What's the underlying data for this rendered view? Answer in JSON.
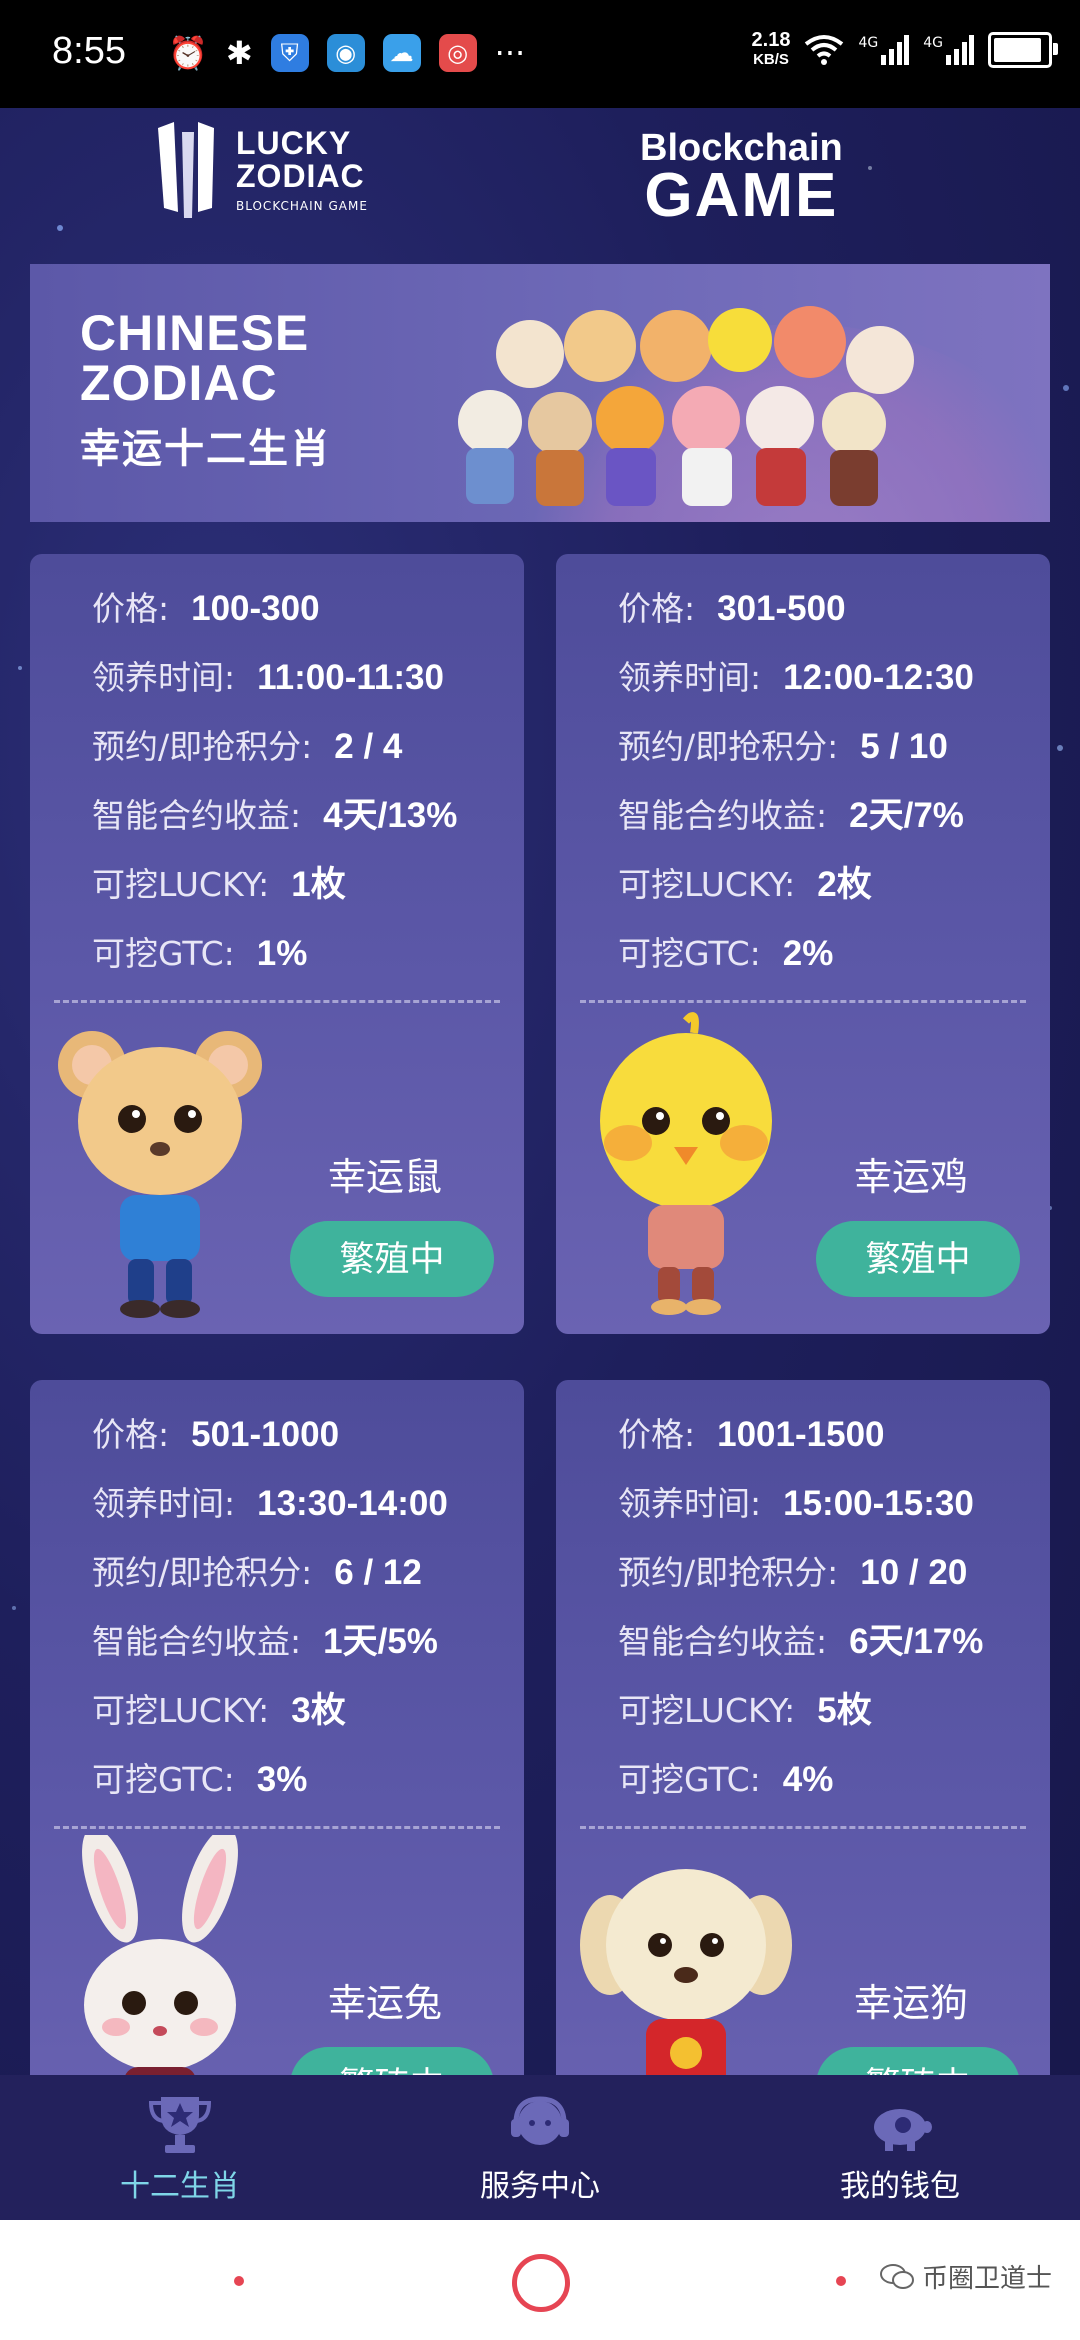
{
  "status_bar": {
    "time": "8:55",
    "network_speed_value": "2.18",
    "network_speed_unit": "KB/S",
    "signal_label_1": "4G",
    "signal_label_2": "4G",
    "more": "···",
    "battery_level": 0.9
  },
  "header": {
    "logo_left_line1": "LUCKY",
    "logo_left_line2": "ZODIAC",
    "logo_left_sub": "BLOCKCHAIN GAME",
    "logo_right_line1": "Blockchain",
    "logo_right_line2": "GAME"
  },
  "banner": {
    "line1": "CHINESE",
    "line2": "ZODIAC",
    "line3": "幸运十二生肖"
  },
  "cards": [
    {
      "price_label": "价格:",
      "price": "100-300",
      "time_label": "领养时间:",
      "time": "11:00-11:30",
      "points_label": "预约/即抢积分:",
      "points": "2 / 4",
      "yield_label": "智能合约收益:",
      "yield": "4天/13%",
      "lucky_label": "可挖LUCKY:",
      "lucky": "1枚",
      "gtc_label": "可挖GTC:",
      "gtc": "1%",
      "name": "幸运鼠",
      "button": "繁殖中",
      "icon": "rat-character-icon"
    },
    {
      "price_label": "价格:",
      "price": "301-500",
      "time_label": "领养时间:",
      "time": "12:00-12:30",
      "points_label": "预约/即抢积分:",
      "points": "5 / 10",
      "yield_label": "智能合约收益:",
      "yield": "2天/7%",
      "lucky_label": "可挖LUCKY:",
      "lucky": "2枚",
      "gtc_label": "可挖GTC:",
      "gtc": "2%",
      "name": "幸运鸡",
      "button": "繁殖中",
      "icon": "chicken-character-icon"
    },
    {
      "price_label": "价格:",
      "price": "501-1000",
      "time_label": "领养时间:",
      "time": "13:30-14:00",
      "points_label": "预约/即抢积分:",
      "points": "6 / 12",
      "yield_label": "智能合约收益:",
      "yield": "1天/5%",
      "lucky_label": "可挖LUCKY:",
      "lucky": "3枚",
      "gtc_label": "可挖GTC:",
      "gtc": "3%",
      "name": "幸运兔",
      "button": "繁殖中",
      "icon": "rabbit-character-icon"
    },
    {
      "price_label": "价格:",
      "price": "1001-1500",
      "time_label": "领养时间:",
      "time": "15:00-15:30",
      "points_label": "预约/即抢积分:",
      "points": "10 / 20",
      "yield_label": "智能合约收益:",
      "yield": "6天/17%",
      "lucky_label": "可挖LUCKY:",
      "lucky": "5枚",
      "gtc_label": "可挖GTC:",
      "gtc": "4%",
      "name": "幸运狗",
      "button": "繁殖中",
      "icon": "dog-character-icon"
    }
  ],
  "bottom_nav": [
    {
      "label": "十二生肖",
      "icon": "trophy-icon",
      "active": true
    },
    {
      "label": "服务中心",
      "icon": "headset-icon",
      "active": false
    },
    {
      "label": "我的钱包",
      "icon": "piggy-bank-icon",
      "active": false
    }
  ],
  "watermark": {
    "text": "币圈卫道士",
    "icon": "wechat-icon"
  },
  "colors": {
    "background": "#1d1d55",
    "card": "#5c58a8",
    "button": "#3fb39c",
    "active_tab": "#7fd6e8",
    "system_accent": "#e64553"
  }
}
